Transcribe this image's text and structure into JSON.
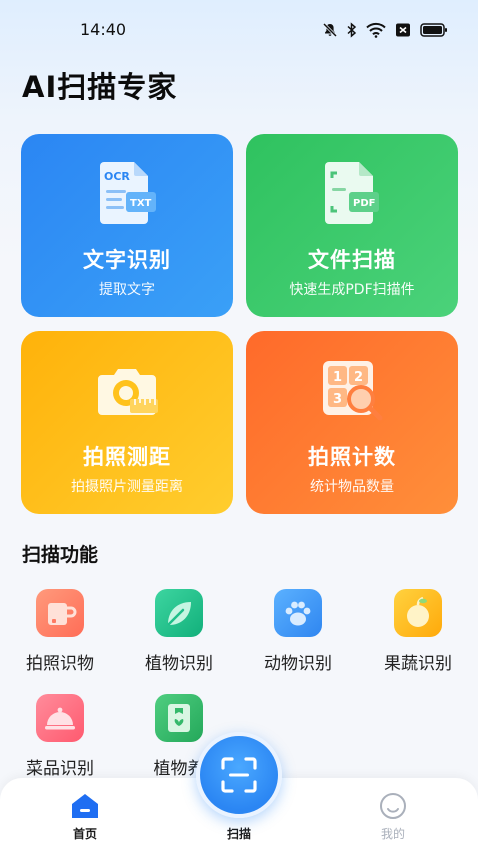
{
  "status_bar": {
    "time": "14:40",
    "icons": [
      "mute-icon",
      "bluetooth-icon",
      "wifi-icon",
      "close-box-icon",
      "battery-icon"
    ]
  },
  "app": {
    "title": "AI扫描专家"
  },
  "cards": [
    {
      "id": "ocr",
      "title": "文字识别",
      "subtitle": "提取文字",
      "icon": "ocr-document-icon",
      "color": "#2b86f3"
    },
    {
      "id": "doc",
      "title": "文件扫描",
      "subtitle": "快速生成PDF扫描件",
      "icon": "pdf-document-icon",
      "color": "#2fc25f"
    },
    {
      "id": "measure",
      "title": "拍照测距",
      "subtitle": "拍摄照片测量距离",
      "icon": "camera-ruler-icon",
      "color": "#ffb20a"
    },
    {
      "id": "count",
      "title": "拍照计数",
      "subtitle": "统计物品数量",
      "icon": "count-magnifier-icon",
      "color": "#ff6a2a"
    }
  ],
  "ocr_icon_text": {
    "top": "OCR",
    "badge": "TXT"
  },
  "doc_icon_text": {
    "badge": "PDF"
  },
  "count_icon_text": {
    "n1": "1",
    "n2": "2",
    "n3": "3"
  },
  "section": {
    "title": "扫描功能"
  },
  "features": [
    {
      "label": "拍照识物",
      "icon": "cup-icon",
      "color": "#ff7a62"
    },
    {
      "label": "植物识别",
      "icon": "leaf-icon",
      "color": "#1fbf8a"
    },
    {
      "label": "动物识别",
      "icon": "paw-icon",
      "color": "#3f97f6"
    },
    {
      "label": "果蔬识别",
      "icon": "fruit-icon",
      "color": "#ffb915"
    },
    {
      "label": "菜品识别",
      "icon": "food-cover-icon",
      "color": "#ff6478"
    },
    {
      "label": "植物养",
      "icon": "plant-card-icon",
      "color": "#35b96b"
    }
  ],
  "bottom_nav": {
    "home": "首页",
    "scan": "扫描",
    "mine": "我的"
  }
}
